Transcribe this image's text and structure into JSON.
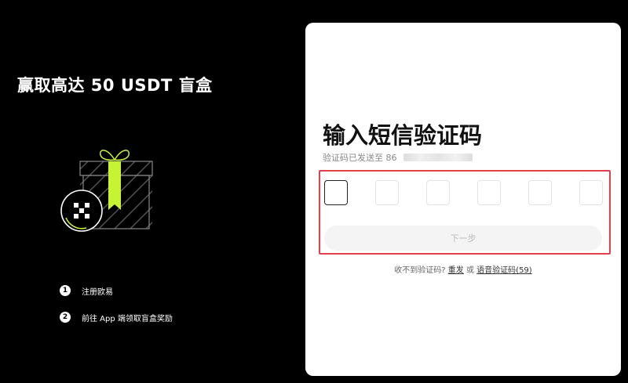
{
  "promo": {
    "title": "赢取高达 50 USDT 盲盒",
    "steps": [
      {
        "num": "1",
        "text": "注册欧易"
      },
      {
        "num": "2",
        "text": "前往 App 端领取盲盒奖励"
      }
    ]
  },
  "verify": {
    "heading": "输入短信验证码",
    "sent_prefix": "验证码已发送至 86",
    "next_button": "下一步",
    "not_received": "收不到验证码?",
    "resend_link": "重发",
    "or": "或",
    "voice_link": "语音验证码(59)"
  },
  "colors": {
    "background": "#000000",
    "card": "#ffffff",
    "accent_lime": "#c6f432",
    "highlight_border": "#e0404a"
  },
  "icons": [
    "gift-box-icon",
    "okx-logo-icon"
  ]
}
